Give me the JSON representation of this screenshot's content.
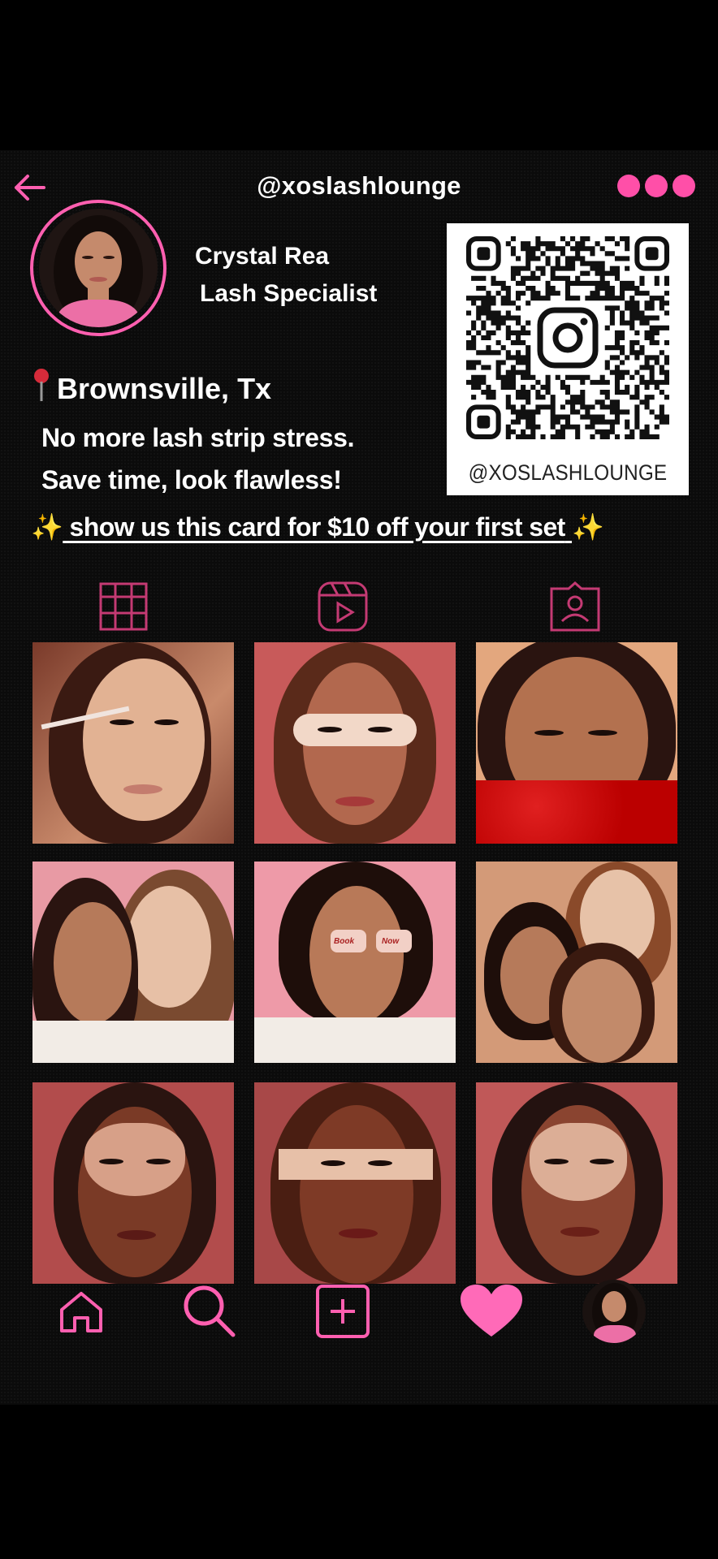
{
  "header": {
    "handle": "@xoslashlounge"
  },
  "profile": {
    "name": "Crystal Rea",
    "title": "Lash Specialist",
    "location_pin": "📍",
    "location": "Brownsville, Tx",
    "bio_line1": "No more lash strip stress.",
    "bio_line2": "Save time, look flawless!"
  },
  "qr": {
    "label": "@XOSLASHLOUNGE"
  },
  "promo": {
    "sparkle_left": "✨",
    "text": "show us this card for $10 off your first set",
    "sparkle_right": "✨"
  },
  "post_text": {
    "book": "Book",
    "now": "Now"
  },
  "tabs": [
    "grid-icon",
    "reels-icon",
    "tagged-icon"
  ],
  "bottom_nav": [
    "home-icon",
    "search-icon",
    "add-post-icon",
    "heart-icon",
    "profile-avatar"
  ],
  "colors": {
    "accent": "#ff5fb0",
    "background": "#0b0b0b",
    "text": "#ffffff"
  }
}
